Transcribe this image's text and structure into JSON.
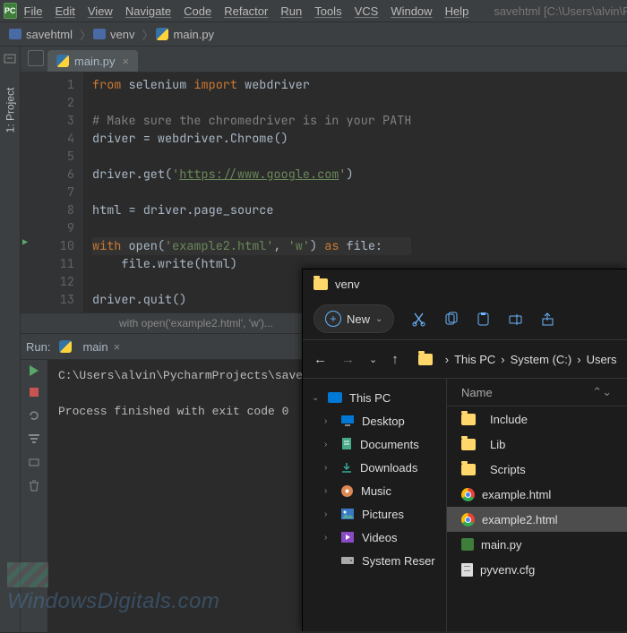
{
  "menubar": {
    "app": "PC",
    "items": [
      "File",
      "Edit",
      "View",
      "Navigate",
      "Code",
      "Refactor",
      "Run",
      "Tools",
      "VCS",
      "Window",
      "Help"
    ],
    "project_path": "savehtml [C:\\Users\\alvin\\PycharmP"
  },
  "breadcrumbs": {
    "items": [
      {
        "icon": "dir",
        "label": "savehtml"
      },
      {
        "icon": "dir",
        "label": "venv"
      },
      {
        "icon": "py",
        "label": "main.py"
      }
    ]
  },
  "sidebar": {
    "project_tab": "1: Project"
  },
  "tabs": {
    "active": {
      "label": "main.py"
    }
  },
  "editor": {
    "line_numbers": [
      "1",
      "2",
      "3",
      "4",
      "5",
      "6",
      "7",
      "8",
      "9",
      "10",
      "11",
      "12",
      "13"
    ],
    "code": [
      {
        "segments": [
          {
            "t": "from ",
            "c": "kw"
          },
          {
            "t": "selenium ",
            "c": ""
          },
          {
            "t": "import ",
            "c": "kw"
          },
          {
            "t": "webdriver",
            "c": ""
          }
        ]
      },
      {
        "segments": []
      },
      {
        "segments": [
          {
            "t": "# Make sure the chromedriver is in your PATH",
            "c": "cmt"
          }
        ]
      },
      {
        "segments": [
          {
            "t": "driver = webdriver.Chrome()",
            "c": ""
          }
        ]
      },
      {
        "segments": []
      },
      {
        "segments": [
          {
            "t": "driver.get(",
            "c": ""
          },
          {
            "t": "'",
            "c": "str"
          },
          {
            "t": "https://www.google.com",
            "c": "str-u"
          },
          {
            "t": "'",
            "c": "str"
          },
          {
            "t": ")",
            "c": ""
          }
        ]
      },
      {
        "segments": []
      },
      {
        "segments": [
          {
            "t": "html = driver.page_source",
            "c": ""
          }
        ]
      },
      {
        "segments": []
      },
      {
        "segments": [
          {
            "t": "with ",
            "c": "kw"
          },
          {
            "t": "open(",
            "c": ""
          },
          {
            "t": "'example2.html'",
            "c": "str"
          },
          {
            "t": ", ",
            "c": ""
          },
          {
            "t": "'w'",
            "c": "str"
          },
          {
            "t": ") ",
            "c": ""
          },
          {
            "t": "as ",
            "c": "kw"
          },
          {
            "t": "file:",
            "c": ""
          }
        ],
        "hl": true
      },
      {
        "segments": [
          {
            "t": "    file.write(html)",
            "c": ""
          }
        ]
      },
      {
        "segments": []
      },
      {
        "segments": [
          {
            "t": "driver.quit()",
            "c": ""
          }
        ]
      }
    ],
    "breadcrumb_fn": "with open('example2.html', 'w')..."
  },
  "run": {
    "label": "Run:",
    "config": "main",
    "output": [
      "C:\\Users\\alvin\\PycharmProjects\\save",
      "",
      "Process finished with exit code 0"
    ]
  },
  "explorer": {
    "title": "venv",
    "new_label": "New",
    "toolbar": [
      "cut",
      "copy",
      "paste",
      "rename",
      "share"
    ],
    "nav": {
      "breadcrumb": [
        "This PC",
        "System (C:)",
        "Users"
      ]
    },
    "tree": [
      {
        "icon": "pc",
        "label": "This PC",
        "chevron": "⌄",
        "indent": 0
      },
      {
        "icon": "desktop",
        "label": "Desktop",
        "chevron": "›",
        "indent": 1
      },
      {
        "icon": "doc",
        "label": "Documents",
        "chevron": "›",
        "indent": 1
      },
      {
        "icon": "down",
        "label": "Downloads",
        "chevron": "›",
        "indent": 1
      },
      {
        "icon": "music",
        "label": "Music",
        "chevron": "›",
        "indent": 1
      },
      {
        "icon": "pic",
        "label": "Pictures",
        "chevron": "›",
        "indent": 1
      },
      {
        "icon": "vid",
        "label": "Videos",
        "chevron": "›",
        "indent": 1
      },
      {
        "icon": "drive",
        "label": "System Reser",
        "chevron": "",
        "indent": 1
      }
    ],
    "list": {
      "header": "Name",
      "items": [
        {
          "icon": "folder",
          "label": "Include"
        },
        {
          "icon": "folder",
          "label": "Lib"
        },
        {
          "icon": "folder",
          "label": "Scripts"
        },
        {
          "icon": "chrome",
          "label": "example.html"
        },
        {
          "icon": "chrome",
          "label": "example2.html",
          "selected": true
        },
        {
          "icon": "pyc",
          "label": "main.py"
        },
        {
          "icon": "cfg",
          "label": "pyvenv.cfg"
        }
      ]
    }
  },
  "watermark": "WindowsDigitals.com"
}
